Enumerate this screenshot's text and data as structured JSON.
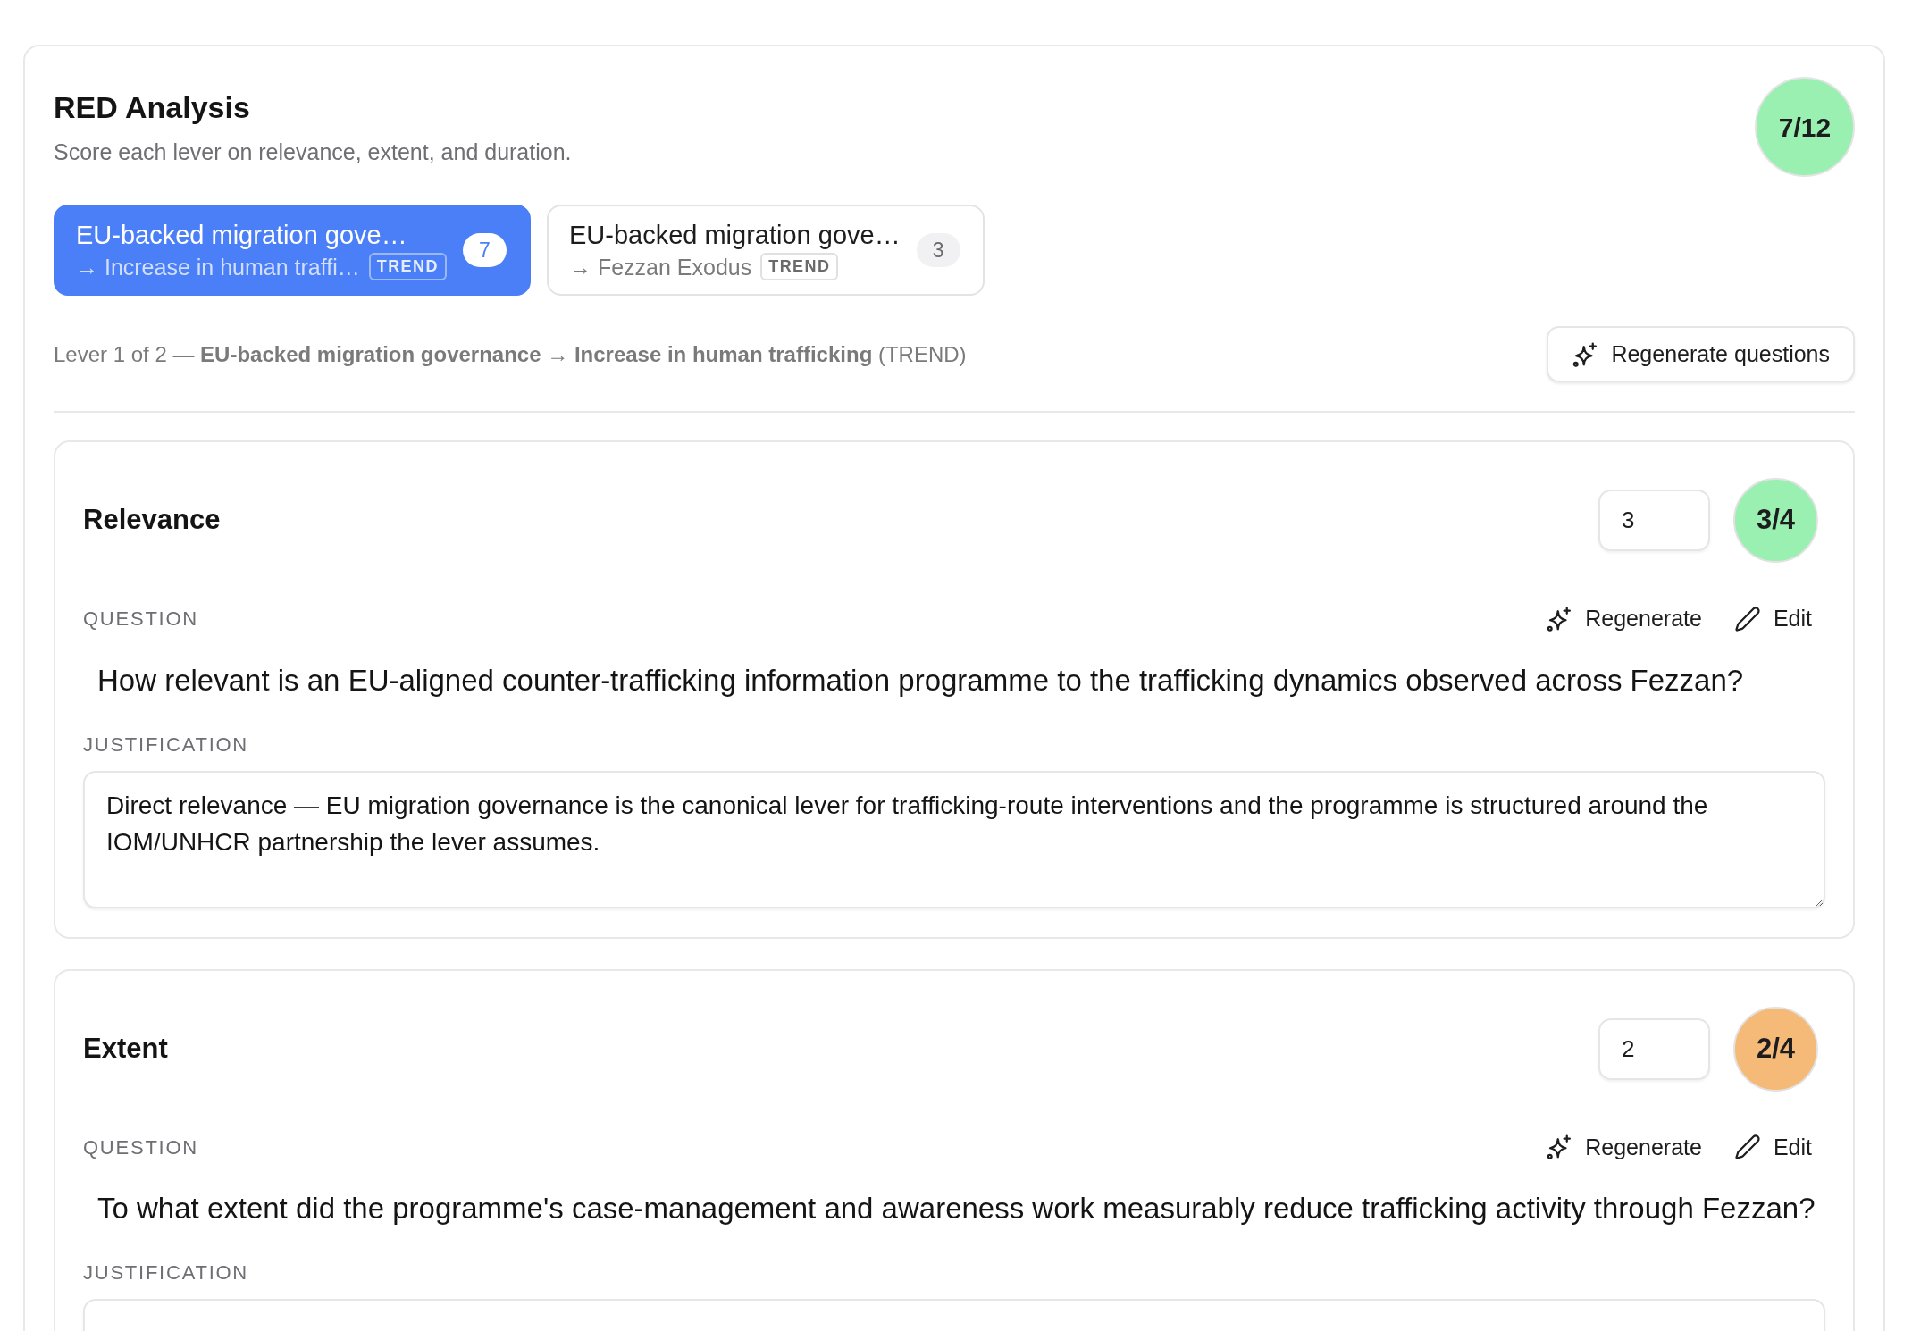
{
  "panel": {
    "title": "RED Analysis",
    "subtitle": "Score each lever on relevance, extent, and duration.",
    "total_score": {
      "text": "7/12",
      "color": "#9af0b1"
    }
  },
  "levers": [
    {
      "title": "EU-backed migration gove…",
      "target": "→ Increase in human traffi…",
      "tag": "TREND",
      "count": "7",
      "selected": true
    },
    {
      "title": "EU-backed migration gove…",
      "target": "→ Fezzan Exodus",
      "tag": "TREND",
      "count": "3",
      "selected": false
    }
  ],
  "breadcrumb": "Lever 1 of 2 — **EU-backed migration governance** → **Increase in human trafficking** (TREND)",
  "regenerate_questions_button": "Regenerate questions",
  "criteria": [
    {
      "name": "Relevance",
      "input_value": "3",
      "score": "3/4",
      "color": "#9af0b1",
      "question_label": "QUESTION",
      "actions": [
        {
          "kind": "regenerate",
          "label": "Regenerate"
        },
        {
          "kind": "edit",
          "label": "Edit"
        }
      ],
      "question": "How relevant is an EU-aligned counter-trafficking information programme to the trafficking dynamics observed across Fezzan?",
      "justification_label": "JUSTIFICATION",
      "justification": "Direct relevance — EU migration governance is the canonical lever for trafficking-route interventions and the programme is structured around the IOM/UNHCR partnership the lever assumes."
    },
    {
      "name": "Extent",
      "input_value": "2",
      "score": "2/4",
      "color": "#f6ba78",
      "question_label": "QUESTION",
      "actions": [
        {
          "kind": "regenerate",
          "label": "Regenerate"
        },
        {
          "kind": "edit",
          "label": "Edit"
        }
      ],
      "question": "To what extent did the programme's case-management and awareness work measurably reduce trafficking activity through Fezzan?",
      "justification_label": "JUSTIFICATION"
    }
  ]
}
